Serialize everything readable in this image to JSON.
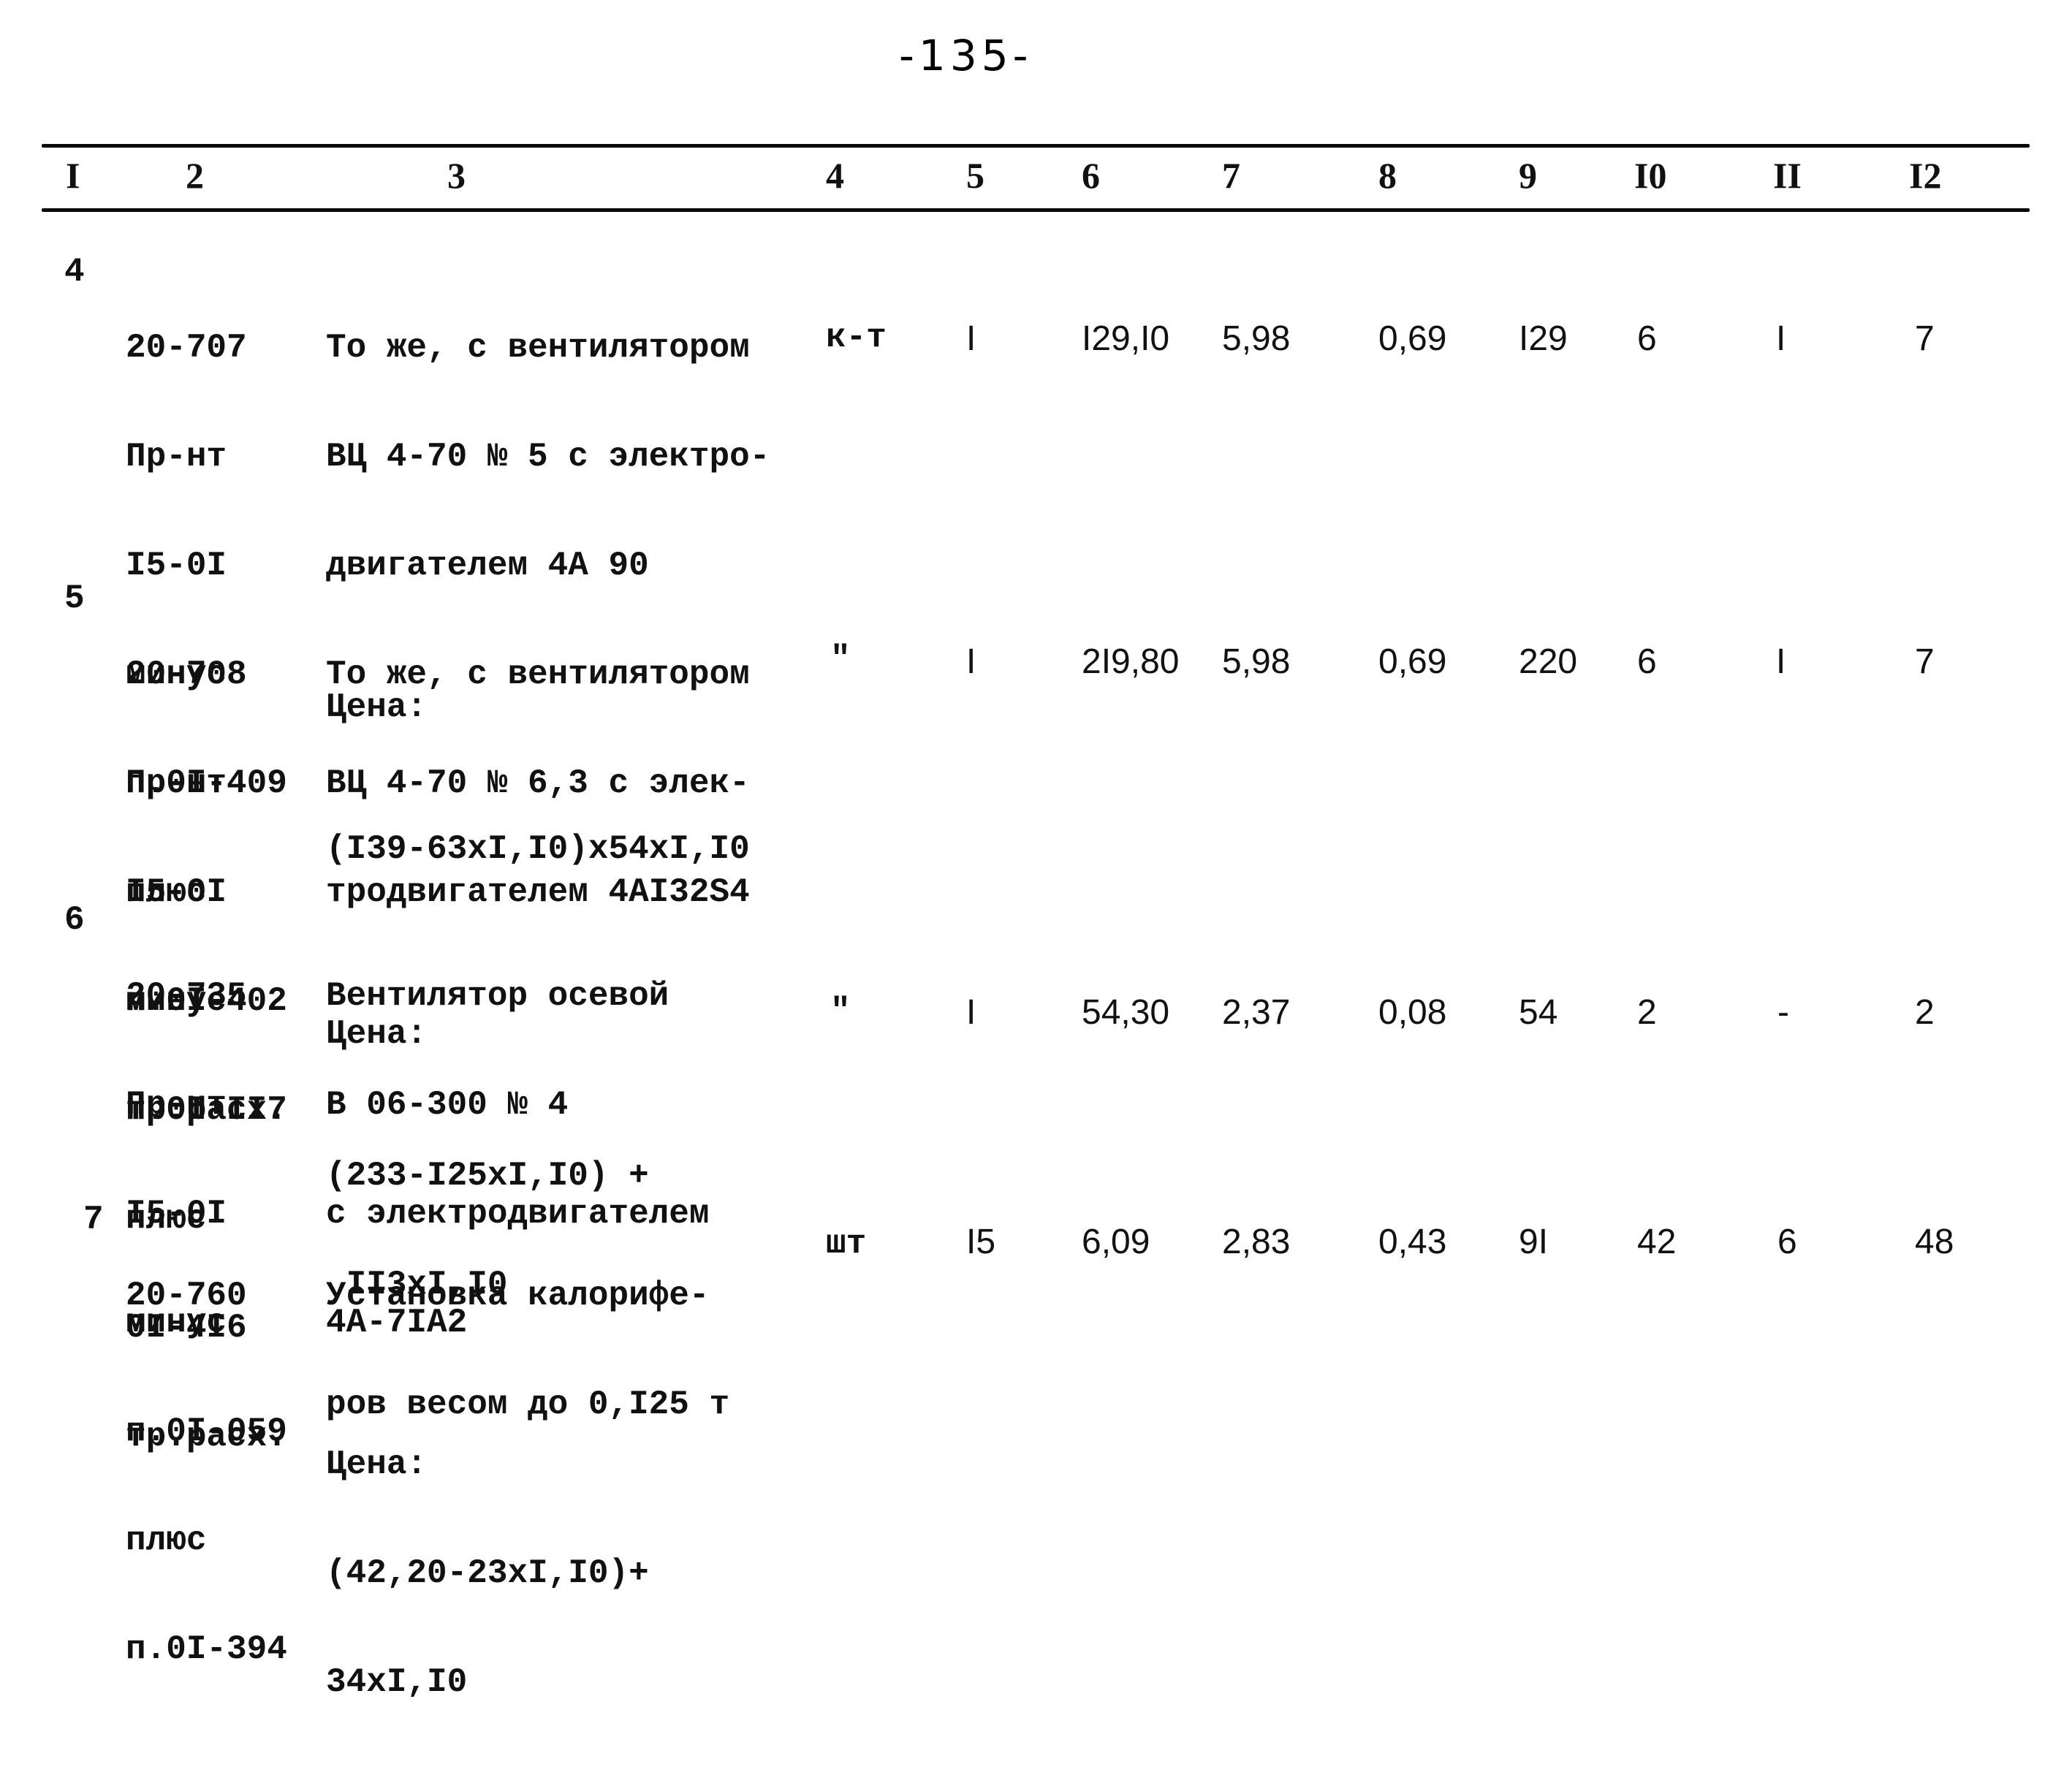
{
  "page_number": "-135-",
  "table": {
    "columns": [
      "I",
      "2",
      "3",
      "4",
      "5",
      "6",
      "7",
      "8",
      "9",
      "I0",
      "II",
      "I2"
    ],
    "rows": [
      {
        "no": "4",
        "code": "20-707",
        "code_lines": [
          "Пр-нт",
          "I5-0I",
          "минус",
          "п.0I-409",
          "плюс",
          "п.0I-402",
          "тр.расх."
        ],
        "desc_lines": [
          "То же, с вентилятором",
          "ВЦ 4-70 № 5 с электро-",
          "двигателем 4А 90"
        ],
        "price_label": "Цена:",
        "price_lines": [
          "(I39-63xI,I0)x54xI,I0"
        ],
        "unit": "к-т",
        "qty": "I",
        "c6": "I29,I0",
        "c7": "5,98",
        "c8": "0,69",
        "c9": "I29",
        "c10": "6",
        "c11": "I",
        "c12": "7"
      },
      {
        "no": "5",
        "code": "20-708",
        "code_lines": [
          "Пр-нт",
          "I5-0I",
          "минус",
          "п.0I-II7",
          "плюс",
          "0I-4I6",
          "тр.расх."
        ],
        "desc_lines": [
          "То же, с вентилятором",
          "ВЦ 4-70 № 6,3 с элек-",
          "тродвигателем 4АI32S4"
        ],
        "price_label": "Цена:",
        "price_lines": [
          "(233-I25xI,I0) +",
          " II3xI,I0"
        ],
        "unit": "\"",
        "qty": "I",
        "c6": "2I9,80",
        "c7": "5,98",
        "c8": "0,69",
        "c9": "220",
        "c10": "6",
        "c11": "I",
        "c12": "7"
      },
      {
        "no": "6",
        "code": "20-735",
        "code_lines": [
          "Пр-нт",
          "I5-0I",
          "минус",
          "п.0I-059",
          "плюс",
          "п.0I-394"
        ],
        "desc_lines": [
          "Вентилятор осевой",
          "В 06-300 № 4",
          "с электродвигателем",
          "4А-7IА2"
        ],
        "price_label": "Цена:",
        "price_lines": [
          "(42,20-23xI,I0)+",
          "34xI,I0"
        ],
        "unit": "\"",
        "qty": "I",
        "c6": "54,30",
        "c7": "2,37",
        "c8": "0,08",
        "c9": "54",
        "c10": "2",
        "c11": "-",
        "c12": "2"
      },
      {
        "no": "7",
        "code": "20-760",
        "code_lines": [],
        "desc_lines": [
          "Установка калорифе-",
          "ров весом до 0,I25 т"
        ],
        "price_label": "",
        "price_lines": [],
        "unit": "шт",
        "qty": "I5",
        "c6": "6,09",
        "c7": "2,83",
        "c8": "0,43",
        "c9": "9I",
        "c10": "42",
        "c11": "6",
        "c12": "48"
      }
    ]
  }
}
